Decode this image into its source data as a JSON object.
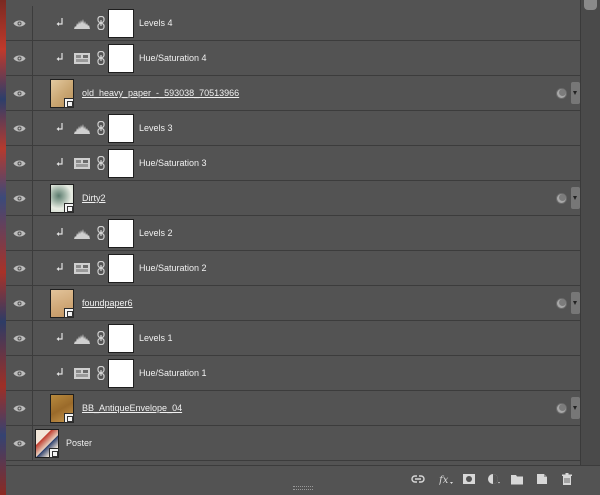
{
  "colors": {
    "panel": "#535353",
    "row_border": "#3c3c3c",
    "text": "#f0f0f0",
    "mask": "#ffffff"
  },
  "layers": [
    {
      "kind": "adjustment",
      "adjust": "levels",
      "name": "Levels 4",
      "visible": true,
      "clipped": true
    },
    {
      "kind": "adjustment",
      "adjust": "hue",
      "name": "Hue/Saturation 4",
      "visible": true,
      "clipped": true
    },
    {
      "kind": "image",
      "name": "old_heavy_paper_-_593038_70513966",
      "visible": true,
      "fx": true,
      "thumb": "paper-light"
    },
    {
      "kind": "adjustment",
      "adjust": "levels",
      "name": "Levels 3",
      "visible": true,
      "clipped": true
    },
    {
      "kind": "adjustment",
      "adjust": "hue",
      "name": "Hue/Saturation 3",
      "visible": true,
      "clipped": true
    },
    {
      "kind": "image",
      "name": "Dirty2",
      "visible": true,
      "fx": true,
      "thumb": "dirty"
    },
    {
      "kind": "adjustment",
      "adjust": "levels",
      "name": "Levels 2",
      "visible": true,
      "clipped": true
    },
    {
      "kind": "adjustment",
      "adjust": "hue",
      "name": "Hue/Saturation 2",
      "visible": true,
      "clipped": true
    },
    {
      "kind": "image",
      "name": "foundpaper6",
      "visible": true,
      "fx": true,
      "thumb": "paper-tan"
    },
    {
      "kind": "adjustment",
      "adjust": "levels",
      "name": "Levels 1",
      "visible": true,
      "clipped": true
    },
    {
      "kind": "adjustment",
      "adjust": "hue",
      "name": "Hue/Saturation 1",
      "visible": true,
      "clipped": true
    },
    {
      "kind": "image",
      "name": "BB_AntiqueEnvelope_04",
      "visible": true,
      "fx": true,
      "thumb": "envelope"
    },
    {
      "kind": "poster",
      "name": "Poster",
      "visible": true,
      "fx": false,
      "thumb": "poster"
    }
  ],
  "footer_icons": [
    "link-layers-icon",
    "fx-icon",
    "add-mask-icon",
    "adjustment-layer-icon",
    "new-group-icon",
    "new-layer-icon",
    "delete-layer-icon"
  ]
}
